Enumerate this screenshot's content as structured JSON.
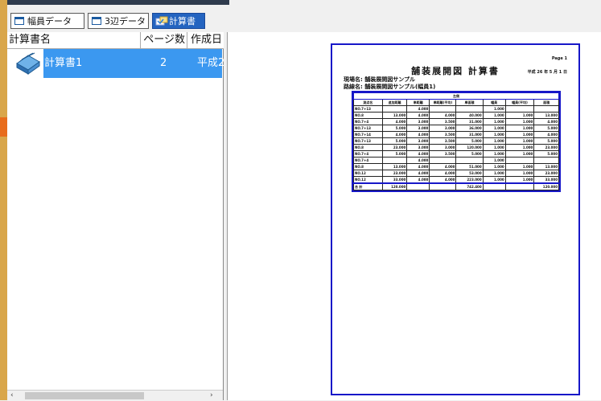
{
  "tabs": [
    {
      "label": "幅員データ",
      "icon": "window-icon"
    },
    {
      "label": "3辺データ",
      "icon": "window-icon"
    },
    {
      "label": "計算書",
      "icon": "calculator-icon",
      "active": true
    }
  ],
  "list": {
    "columns": [
      "計算書名",
      "ページ数",
      "作成日"
    ],
    "rows": [
      {
        "name": "計算書1",
        "pages": "2",
        "date": "平成2"
      }
    ]
  },
  "preview": {
    "page_label": "Page 1",
    "title": "舗装展開図 計算書",
    "date": "平成 26 年 5 月 1 日",
    "site": "現場名: 舗装展開図サンプル",
    "route": "路線名: 舗装展開図サンプル(幅員1)",
    "group_label": "左側",
    "headers": [
      "測点名",
      "追加距離",
      "単距離",
      "単距離(平均)",
      "単面積",
      "幅員",
      "幅員(平均)",
      "面積"
    ],
    "rows": [
      [
        "NO.7+13",
        "",
        "4.000",
        "",
        "",
        "1.000",
        "",
        ""
      ],
      [
        "NO.8",
        "13.000",
        "4.000",
        "4.000",
        "40.000",
        "1.000",
        "1.000",
        "13.000"
      ],
      [
        "NO.7+4",
        "4.000",
        "3.000",
        "3.500",
        "31.000",
        "1.000",
        "1.000",
        "4.000"
      ],
      [
        "NO.7+13",
        "5.000",
        "3.000",
        "3.000",
        "36.000",
        "1.000",
        "1.000",
        "5.000"
      ],
      [
        "NO.7+14",
        "4.000",
        "4.000",
        "3.500",
        "31.000",
        "1.000",
        "1.000",
        "4.000"
      ],
      [
        "NO.7+13",
        "5.000",
        "3.000",
        "3.500",
        "5.000",
        "1.000",
        "1.000",
        "5.000"
      ],
      [
        "NO.8",
        "23.000",
        "3.000",
        "3.000",
        "120.000",
        "1.000",
        "1.000",
        "23.000"
      ],
      [
        "NO.7+4",
        "5.000",
        "4.000",
        "3.500",
        "5.000",
        "1.000",
        "1.000",
        "5.000"
      ],
      [
        "NO.7+4",
        "",
        "4.000",
        "",
        "",
        "1.000",
        "",
        ""
      ],
      [
        "NO.8",
        "13.000",
        "4.000",
        "4.000",
        "51.000",
        "1.000",
        "1.000",
        "13.000"
      ],
      [
        "NO.12",
        "23.000",
        "4.000",
        "4.000",
        "53.000",
        "1.000",
        "1.000",
        "23.000"
      ],
      [
        "NO.12",
        "33.000",
        "4.000",
        "4.000",
        "223.000",
        "1.000",
        "1.000",
        "33.000"
      ]
    ],
    "total": [
      "合 計",
      "120.000",
      "",
      "",
      "742.400",
      "",
      "",
      "120.000"
    ]
  },
  "colors": {
    "accent_blue": "#2464c0",
    "selection_blue": "#3b98f0",
    "page_border": "#1717c8",
    "strip_orange": "#d9a64a",
    "arrow_orange": "#e86c1c"
  }
}
